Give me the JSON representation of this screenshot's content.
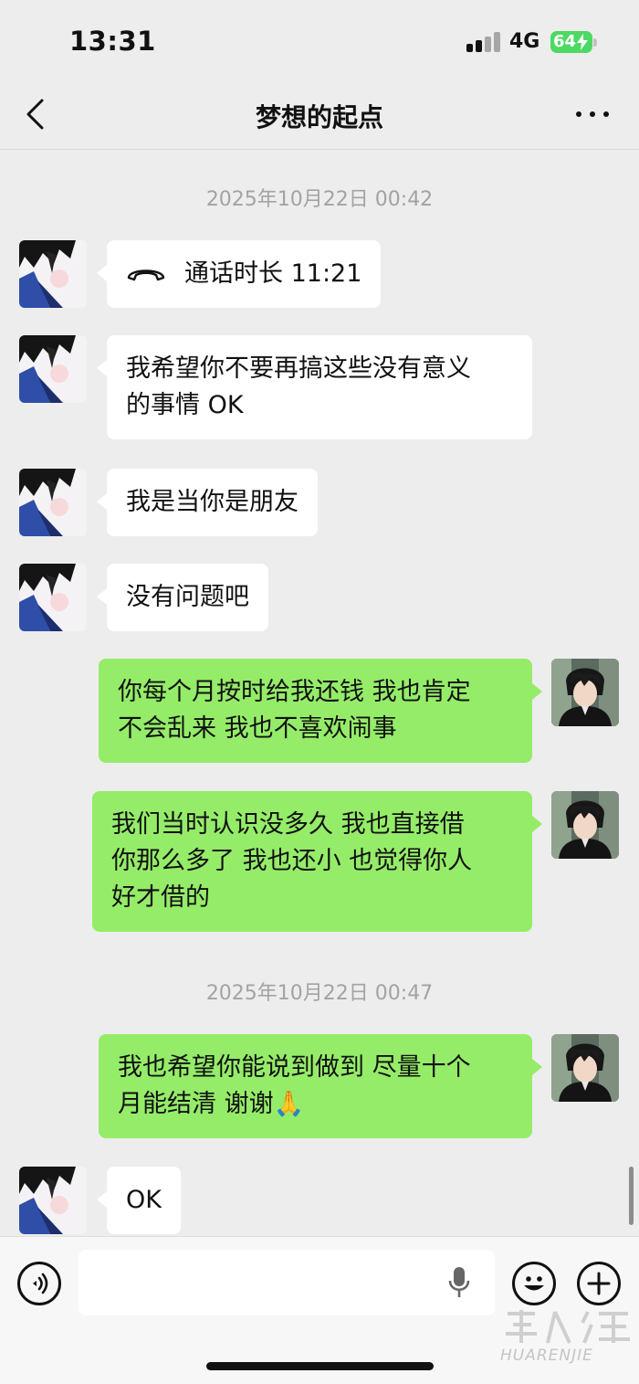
{
  "status_bar": {
    "time": "13:31",
    "network": "4G",
    "battery": "64"
  },
  "nav": {
    "title": "梦想的起点",
    "back_icon": "chevron-left-icon",
    "more_icon": "more-dots-icon"
  },
  "messages": [
    {
      "kind": "timestamp",
      "text": "2025年10月22日 00:42"
    },
    {
      "kind": "call",
      "sender": "other",
      "text": "通话时长 11:21",
      "icon": "phone-hangup-icon"
    },
    {
      "kind": "text",
      "sender": "other",
      "lines": [
        "我希望你不要再搞这些没有意义",
        "的事情 OK"
      ]
    },
    {
      "kind": "text",
      "sender": "other",
      "lines": [
        "我是当你是朋友"
      ]
    },
    {
      "kind": "text",
      "sender": "other",
      "lines": [
        "没有问题吧"
      ]
    },
    {
      "kind": "text",
      "sender": "self",
      "lines": [
        "你每个月按时给我还钱 我也肯定",
        "不会乱来  我也不喜欢闹事"
      ]
    },
    {
      "kind": "text",
      "sender": "self",
      "lines": [
        "我们当时认识没多久 我也直接借",
        "你那么多了 我也还小 也觉得你人",
        "好才借的"
      ]
    },
    {
      "kind": "timestamp",
      "text": "2025年10月22日 00:47"
    },
    {
      "kind": "text",
      "sender": "self",
      "lines": [
        "我也希望你能说到做到 尽量十个",
        "月能结清 谢谢🙏"
      ]
    },
    {
      "kind": "text",
      "sender": "other",
      "lines": [
        "OK"
      ]
    }
  ],
  "input_bar": {
    "placeholder": "",
    "voice_icon": "voice-icon",
    "mic_icon": "microphone-icon",
    "emoji_icon": "emoji-icon",
    "plus_icon": "plus-icon"
  },
  "watermark": {
    "text": "HUARENJIE"
  },
  "colors": {
    "background": "#ededed",
    "incoming_bubble": "#ffffff",
    "outgoing_bubble": "#95ec69",
    "battery": "#4cd964"
  }
}
